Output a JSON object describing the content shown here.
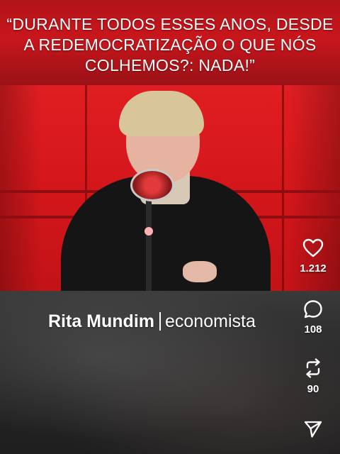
{
  "headline": {
    "text": "“DURANTE TODOS ESSES ANOS, DESDE\nA REDEMOCRATIZAÇÃO O QUE NÓS\nCOLHEMOS?: NADA!”"
  },
  "lower_third": {
    "name": "Rita Mundim",
    "role": "economista"
  },
  "actions": {
    "like": {
      "icon": "heart-icon",
      "count": "1.212"
    },
    "comment": {
      "icon": "comment-bubble-icon",
      "count": "108"
    },
    "repost": {
      "icon": "repost-icon",
      "count": "90"
    },
    "share": {
      "icon": "send-icon"
    }
  },
  "colors": {
    "studio_red": "#d4181b",
    "caption_band": "#c8161c",
    "text": "#ffffff"
  }
}
